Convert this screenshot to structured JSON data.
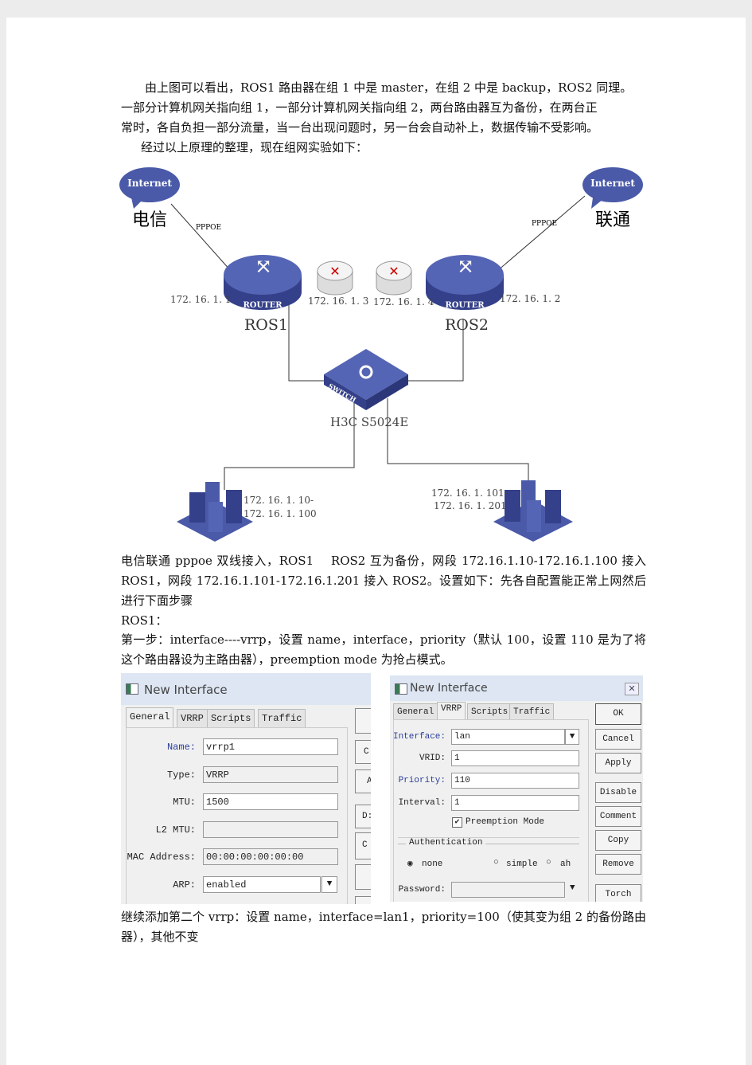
{
  "paragraphs": {
    "p1_line1": "由上图可以看出，ROS1 路由器在组 1 中是 master，在组 2 中是 backup，ROS2 同理。",
    "p1_line2": "一部分计算机网关指向组 1，一部分计算机网关指向组 2，两台路由器互为备份，在两台正",
    "p1_line3": "常时，各自负担一部分流量，当一台出现问题时，另一台会自动补上，数据传输不受影响。",
    "p2": "经过以上原理的整理，现在组网实验如下：",
    "p3": "电信联通 pppoe 双线接入，ROS1　 ROS2 互为备份，网段 172.16.1.10-172.16.1.100 接入 ROS1，网段 172.16.1.101-172.16.1.201 接入 ROS2。设置如下：先各自配置能正常上网然后进行下面步骤",
    "p4": "ROS1：",
    "p5": "第一步：interface----vrrp，设置 name，interface，priority（默认 100，设置 110 是为了将这个路由器设为主路由器），preemption mode 为抢占模式。",
    "p6": "继续添加第二个 vrrp：设置 name，interface=lan1，priority=100（使其变为组 2 的备份路由器），其他不变"
  },
  "diagram": {
    "cloud_left": "Internet",
    "cloud_right": "Internet",
    "isp_left": "电信",
    "isp_right": "联通",
    "pppoe_left": "PPPOE",
    "pppoe_right": "PPPOE",
    "router_badge": "ROUTER",
    "ros1": "ROS1",
    "ros2": "ROS2",
    "ip_ros1": "172. 16. 1. 1",
    "ip_ros2": "172. 16. 1. 2",
    "ip_v1": "172. 16. 1. 3",
    "ip_v2": "172. 16. 1. 4",
    "switch_badge": "SWITCH",
    "switch_model": "H3C  S5024E",
    "range1_a": "172. 16. 1. 10-",
    "range1_b": "172. 16. 1. 100",
    "range2_a": "172. 16. 1. 101-",
    "range2_b": "172. 16. 1. 201",
    "colors": {
      "device": "#4a5aa8",
      "line": "#333333"
    }
  },
  "win1": {
    "title": "New Interface",
    "tabs": [
      "General",
      "VRRP",
      "Scripts",
      "Traffic"
    ],
    "fields": [
      {
        "label": "Name:",
        "value": "vrrp1"
      },
      {
        "label": "Type:",
        "value": "VRRP"
      },
      {
        "label": "MTU:",
        "value": "1500"
      },
      {
        "label": "L2 MTU:",
        "value": ""
      },
      {
        "label": "MAC Address:",
        "value": "00:00:00:00:00:00"
      },
      {
        "label": "ARP:",
        "value": "enabled"
      }
    ],
    "side_buttons_partial": [
      "C",
      "A",
      "D:",
      "C"
    ]
  },
  "win2": {
    "title": "New Interface",
    "tabs": [
      "General",
      "VRRP",
      "Scripts",
      "Traffic"
    ],
    "interface_label": "Interface:",
    "interface_value": "lan",
    "vrid_label": "VRID:",
    "vrid_value": "1",
    "priority_label": "Priority:",
    "priority_value": "110",
    "interval_label": "Interval:",
    "interval_value": "1",
    "preemption_label": "Preemption Mode",
    "preemption_checked": true,
    "auth_label": "Authentication",
    "auth_options": [
      "none",
      "simple",
      "ah"
    ],
    "auth_selected": "none",
    "password_label": "Password:",
    "password_value": "",
    "buttons": [
      "OK",
      "Cancel",
      "Apply",
      "Disable",
      "Comment",
      "Copy",
      "Remove",
      "Torch"
    ]
  }
}
